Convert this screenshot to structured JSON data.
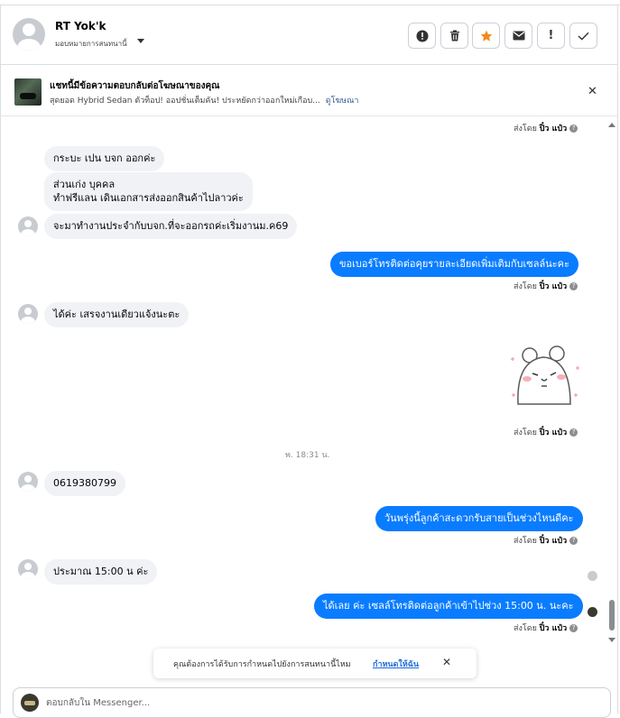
{
  "header": {
    "name": "RT Yok'k",
    "assign_label": "มอบหมายการสนทนานี้",
    "buttons": [
      {
        "name": "alert-circle-button",
        "glyph": "!",
        "label": ""
      },
      {
        "name": "trash-button",
        "glyph": "🗑",
        "label": ""
      },
      {
        "name": "star-button",
        "glyph": "★",
        "label": ""
      },
      {
        "name": "mark-unread-button",
        "glyph": "✉",
        "label": ""
      },
      {
        "name": "important-button",
        "glyph": "!",
        "label": ""
      },
      {
        "name": "done-button",
        "glyph": "✓",
        "label": ""
      }
    ],
    "star_color": "#f28a1e"
  },
  "ad": {
    "title": "แชทนี้มีข้อความตอบกลับต่อโฆษณาของคุณ",
    "desc": "สุดยอด Hybrid Sedan ตัวท็อป! ออปชั่นเต็มคัน! ประหยัดกว่าออกใหม่เกือบ...",
    "link": "ดูโฆษณา"
  },
  "messages": {
    "sent_by_prefix": "ส่งโดย",
    "sent_by_name": "ปิ๋ว แป๋ว",
    "incoming": [
      "กระบะ เปน บจก ออกค่ะ",
      "ส่วนเก่ง บุคคล",
      "ทำฟรีแลน เดินเอกสารส่งออกสินค้าไปลาวค่ะ",
      "จะมาทำงานประจำกับบจก.ที่จะออกรถค่ะเริ่มงานม.ค69",
      "ได้ค่ะ เสรจงานเดียวแจ้งนะตะ",
      "0619380799",
      "ประมาณ 15:00 น ค่ะ"
    ],
    "outgoing": [
      "ขอเบอร์โทรติดต่อคุยรายละเอียดเพิ่มเติมกับเซลล์นะคะ",
      "วันพรุ่งนี้ลูกค้าสะดวกรับสายเป็นช่วงไหนดีคะ",
      "ได้เลย  ค่ะ เซลล์โทรติดต่อลูกค้าเข้าไปช่วง 15:00 น. นะคะ"
    ],
    "time_separator": "พ. 18:31 น.",
    "accent": "#0a7cff"
  },
  "toast": {
    "text": "คุณต้องการได้รับการกำหนดไปยังการสนทนานี้ไหม",
    "link": "กำหนดให้ฉัน"
  },
  "composer": {
    "placeholder": "ตอบกลับใน Messenger..."
  }
}
